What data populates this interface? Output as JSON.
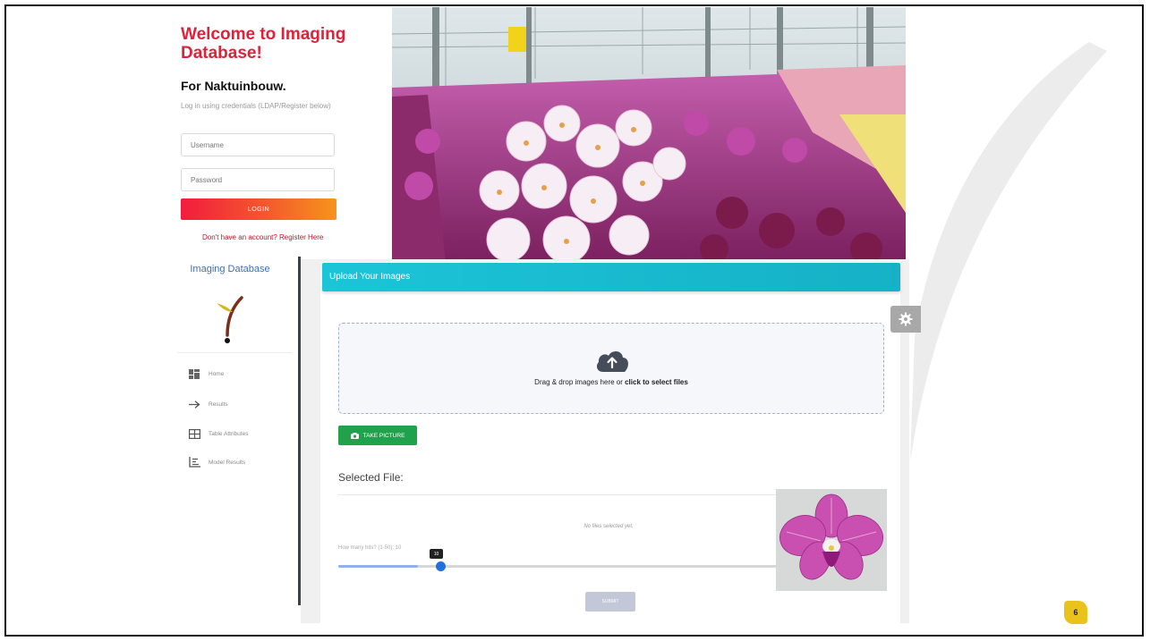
{
  "login": {
    "title": "Welcome to Imaging Database!",
    "subtitle": "For Naktuinbouw.",
    "hint": "Log in using credentials (LDAP/Register below)",
    "username_placeholder": "Username",
    "password_placeholder": "Password",
    "login_label": "LOGIN",
    "register_link": "Don't have an account? Register Here"
  },
  "sidebar": {
    "brand": "Imaging Database",
    "items": [
      {
        "label": "Home",
        "icon": "dashboard-icon"
      },
      {
        "label": "Results",
        "icon": "arrow-right-icon"
      },
      {
        "label": "Table Attributes",
        "icon": "table-icon"
      },
      {
        "label": "Model Results",
        "icon": "list-chart-icon"
      }
    ]
  },
  "upload": {
    "header": "Upload Your Images",
    "dropzone_text": "Drag & drop images here or ",
    "dropzone_link": "click to select files",
    "take_picture": "TAKE PICTURE",
    "selected_title": "Selected File:",
    "no_files": "No files selected yet.",
    "hits_label": "How many hits? (1-50): 10",
    "hits_value": "10",
    "hits_fraction": 0.18,
    "submit": "SUBMIT"
  },
  "page_number": "6",
  "colors": {
    "accent_red": "#e0213a",
    "header_cyan": "#1cc4d8",
    "take_green": "#20a24d",
    "slider_blue": "#1f6fe0",
    "badge_yellow": "#e9c21c"
  }
}
